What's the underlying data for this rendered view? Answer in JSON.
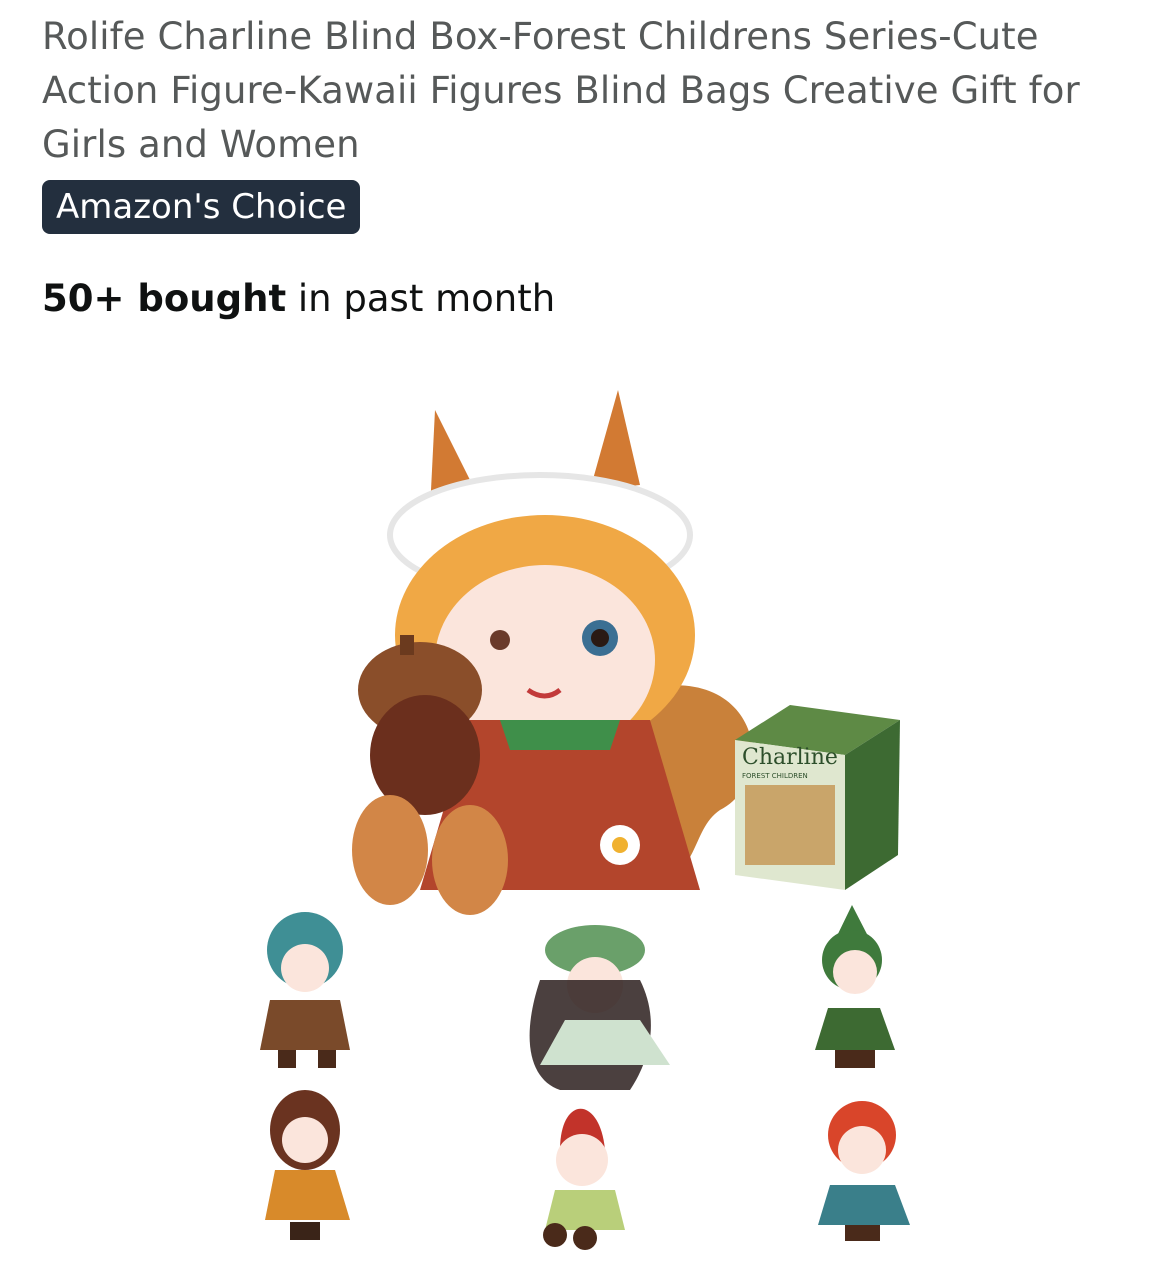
{
  "product": {
    "title": "Rolife Charline Blind Box-Forest Childrens Series-Cute Action Figure-Kawaii Figures Blind Bags Creative Gift for Girls and Women",
    "badge": "Amazon's Choice",
    "bought_count": "50+ bought",
    "bought_suffix": " in past month"
  },
  "image": {
    "box_brand": "Charline",
    "box_subtitle": "FOREST CHILDREN",
    "figure_colors": [
      "#e39a3c",
      "#3f8f95",
      "#2b1f1d",
      "#3f7a3c",
      "#6a3320",
      "#c2332a",
      "#d9452a"
    ]
  }
}
